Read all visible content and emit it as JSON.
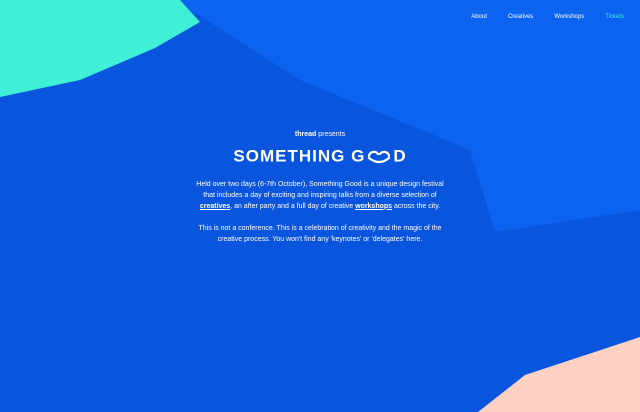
{
  "colors": {
    "background": "#0a55dd",
    "panel_light": "#0b63ef",
    "teal": "#3ff0d6",
    "peach": "#fcd1c1",
    "text": "#ffffff",
    "nav_active": "#3ff0d6"
  },
  "nav": {
    "items": [
      "About",
      "Creatives",
      "Workshops",
      "Tickets"
    ],
    "active": "Tickets"
  },
  "hero": {
    "brand": "thread",
    "presents": " presents",
    "logo_pre": "SOMETHING G",
    "logo_post": "D",
    "logo_icon": "smiling-oo-icon"
  },
  "paragraph1": {
    "t1": "Held over two days (6-7th October), Something Good is a unique design festival that includes a day of exciting and inspiring talks from a diverse selection of ",
    "link1": "creatives",
    "t2": ", an after party and a full day of creative ",
    "link2": "workshops",
    "t3": " across the city."
  },
  "paragraph2": {
    "text": "This is not a conference. This is a celebration of creativity and the magic of the creative process. You won't find any 'keynotes' or 'delegates' here."
  }
}
